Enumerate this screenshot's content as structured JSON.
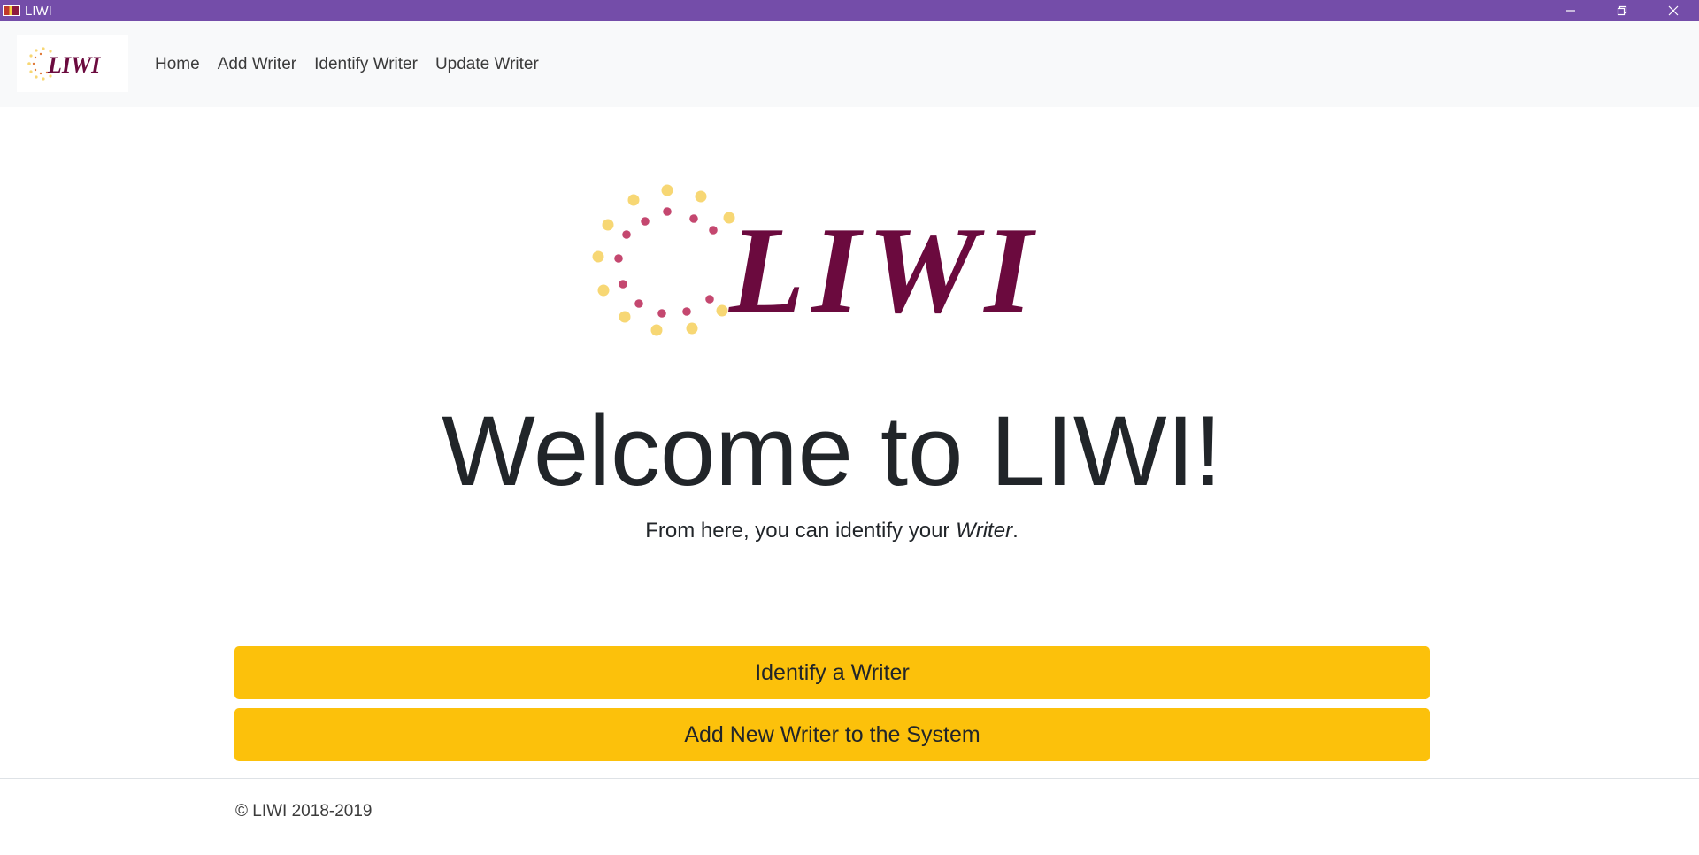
{
  "window": {
    "title": "LIWI",
    "accent_color": "#744da9",
    "controls": [
      "minimize-icon",
      "restore-icon",
      "close-icon"
    ]
  },
  "navbar": {
    "brand_text": "LIWI",
    "links": [
      {
        "label": "Home"
      },
      {
        "label": "Add Writer"
      },
      {
        "label": "Identify Writer"
      },
      {
        "label": "Update Writer"
      }
    ]
  },
  "hero": {
    "logo_text": "LIWI",
    "logo_colors": {
      "wordmark": "#6b0a3e",
      "dots_outer": "#f7d774",
      "dots_inner": "#c4476f"
    },
    "heading": "Welcome to LIWI!",
    "subtitle_prefix": "From here, you can identify your ",
    "subtitle_emphasis": "Writer",
    "subtitle_suffix": "."
  },
  "actions": {
    "identify_label": "Identify a Writer",
    "add_label": "Add New Writer to the System",
    "button_color": "#fcc10b"
  },
  "footer": {
    "copyright": "© LIWI 2018-2019"
  }
}
